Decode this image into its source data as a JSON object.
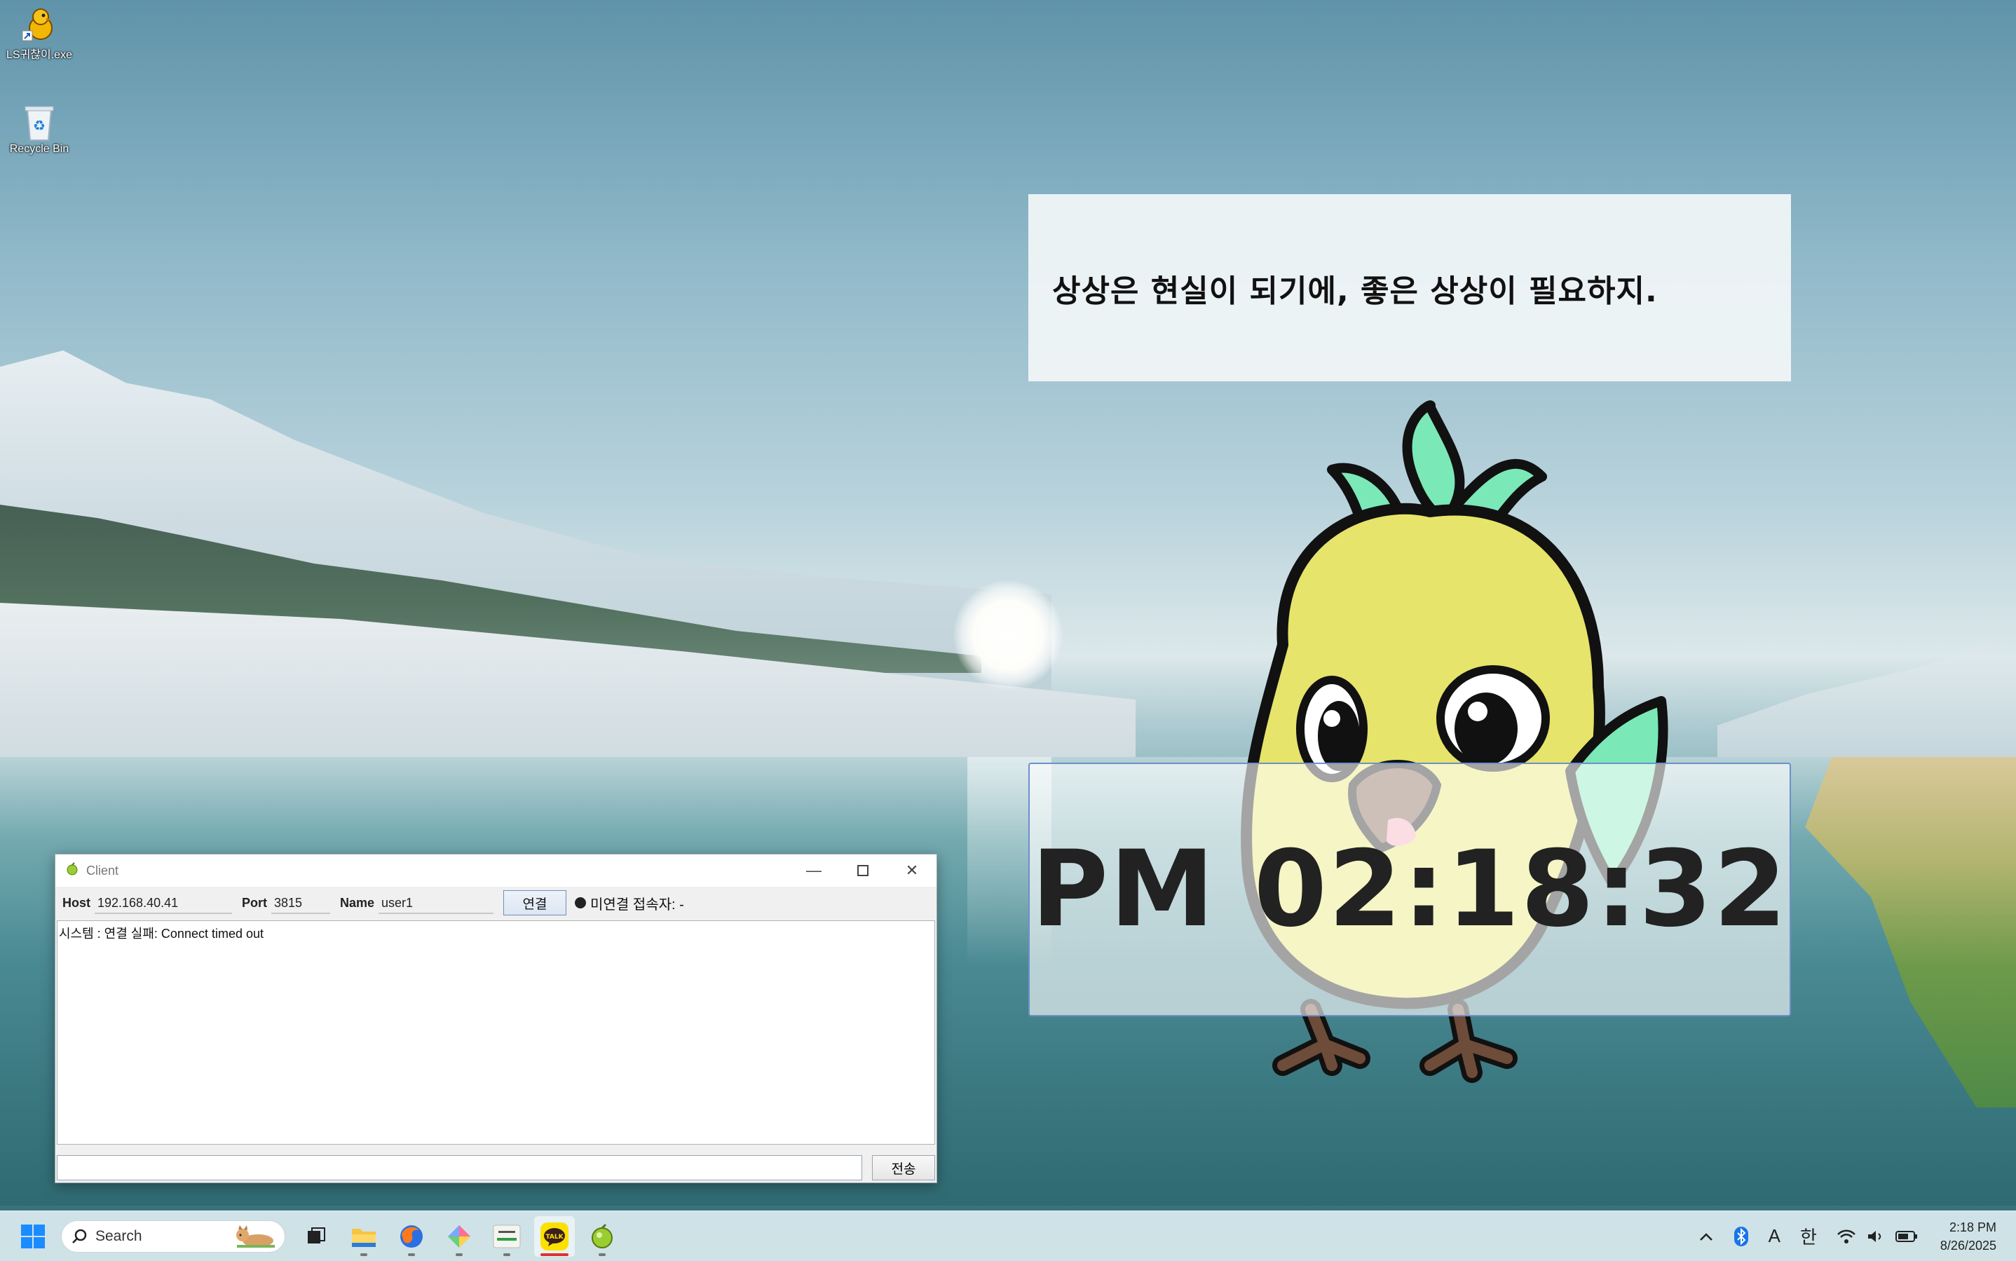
{
  "desktop": {
    "icons": [
      {
        "label": "LS귀찮이.exe"
      },
      {
        "label": "Recycle Bin"
      }
    ],
    "quote": "상상은 현실이 되기에, 좋은 상상이 필요하지.",
    "clock": "PM 02:18:32"
  },
  "client_window": {
    "title": "Client",
    "host_label": "Host",
    "host_value": "192.168.40.41",
    "port_label": "Port",
    "port_value": "3815",
    "name_label": "Name",
    "name_value": "user1",
    "connect_button": "연결",
    "status_text": "미연결 접속자: -",
    "log_lines": [
      "시스템 : 연결 실패: Connect timed out"
    ],
    "message_value": "",
    "send_button": "전송"
  },
  "taskbar": {
    "search_placeholder": "Search",
    "apps": [
      "file-explorer",
      "firefox",
      "app-launcher",
      "lsy-app",
      "kakaotalk",
      "client-app"
    ],
    "active_app": "kakaotalk",
    "kakao_label": "TALK",
    "tray": {
      "ime_mode": "A",
      "ime_lang": "한"
    },
    "time": "2:18 PM",
    "date": "8/26/2025"
  },
  "colors": {
    "accent": "#6f8fc9",
    "kakao": "#fae100",
    "running_indicator": "#e0312b"
  }
}
